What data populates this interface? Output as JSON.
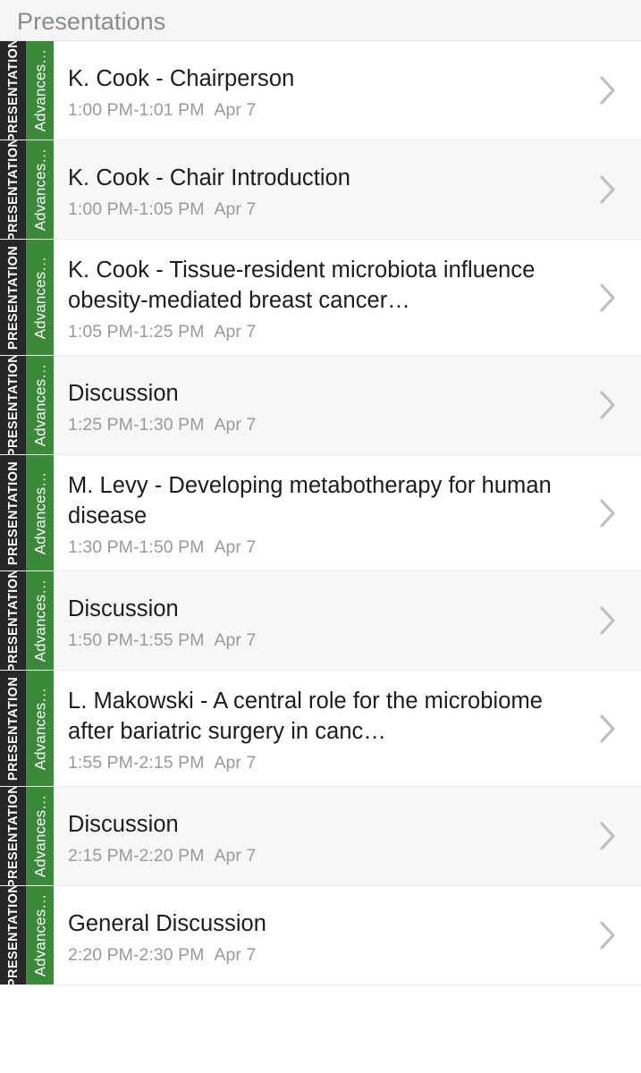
{
  "theme": {
    "accent_green": "#3b8a3a",
    "indicator_green": "#5aa84f",
    "rail_dark": "#272727",
    "header_bg": "#f5f5f5",
    "row_alt_bg": "#f7f7f7",
    "title_color": "#1c1c1c",
    "meta_color": "#9a9a9a",
    "chevron_color": "#c0c0c0"
  },
  "header": {
    "title": "Presentations"
  },
  "rails": {
    "type_label": "PRESENTATION",
    "session_label": "Advances…"
  },
  "list": {
    "items": [
      {
        "title": "K. Cook - Chairperson",
        "time": "1:00 PM-1:01 PM",
        "date": "Apr 7",
        "type_label": "PRESENTATION",
        "session_label": "Advances…",
        "chevron": "chevron-right-icon"
      },
      {
        "title": "K. Cook - Chair Introduction",
        "time": "1:00 PM-1:05 PM",
        "date": "Apr 7",
        "type_label": "PRESENTATION",
        "session_label": "Advances…",
        "chevron": "chevron-right-icon"
      },
      {
        "title": "K. Cook - Tissue-resident microbiota influence obesity-mediated breast cancer…",
        "time": "1:05 PM-1:25 PM",
        "date": "Apr 7",
        "type_label": "PRESENTATION",
        "session_label": "Advances…",
        "chevron": "chevron-right-icon"
      },
      {
        "title": "Discussion",
        "time": "1:25 PM-1:30 PM",
        "date": "Apr 7",
        "type_label": "PRESENTATION",
        "session_label": "Advances…",
        "chevron": "chevron-right-icon"
      },
      {
        "title": "M. Levy - Developing metabotherapy for human disease",
        "time": "1:30 PM-1:50 PM",
        "date": "Apr 7",
        "type_label": "PRESENTATION",
        "session_label": "Advances…",
        "chevron": "chevron-right-icon"
      },
      {
        "title": "Discussion",
        "time": "1:50 PM-1:55 PM",
        "date": "Apr 7",
        "type_label": "PRESENTATION",
        "session_label": "Advances…",
        "chevron": "chevron-right-icon"
      },
      {
        "title": "L. Makowski - A central role for the microbiome after bariatric surgery in canc…",
        "time": "1:55 PM-2:15 PM",
        "date": "Apr 7",
        "type_label": "PRESENTATION",
        "session_label": "Advances…",
        "chevron": "chevron-right-icon"
      },
      {
        "title": "Discussion",
        "time": "2:15 PM-2:20 PM",
        "date": "Apr 7",
        "type_label": "PRESENTATION",
        "session_label": "Advances…",
        "chevron": "chevron-right-icon"
      },
      {
        "title": "General Discussion",
        "time": "2:20 PM-2:30 PM",
        "date": "Apr 7",
        "type_label": "PRESENTATION",
        "session_label": "Advances…",
        "chevron": "chevron-right-icon"
      }
    ]
  }
}
